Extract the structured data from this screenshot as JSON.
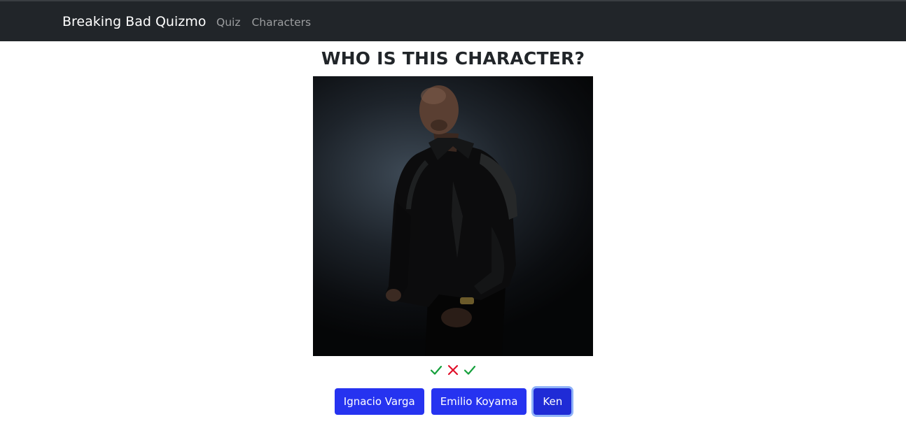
{
  "navbar": {
    "brand": "Breaking Bad Quizmo",
    "links": [
      {
        "label": "Quiz"
      },
      {
        "label": "Characters"
      }
    ]
  },
  "quiz": {
    "title": "WHO IS THIS CHARACTER?",
    "results": [
      {
        "icon": "check-icon",
        "status": "correct"
      },
      {
        "icon": "cross-icon",
        "status": "wrong"
      },
      {
        "icon": "check-icon",
        "status": "correct"
      }
    ],
    "options": [
      {
        "label": "Ignacio Varga"
      },
      {
        "label": "Emilio Koyama"
      },
      {
        "label": "Ken"
      }
    ]
  },
  "colors": {
    "navbar_bg": "#212529",
    "button_bg": "#2633f0",
    "correct": "#15a03c",
    "wrong": "#e0102a"
  }
}
